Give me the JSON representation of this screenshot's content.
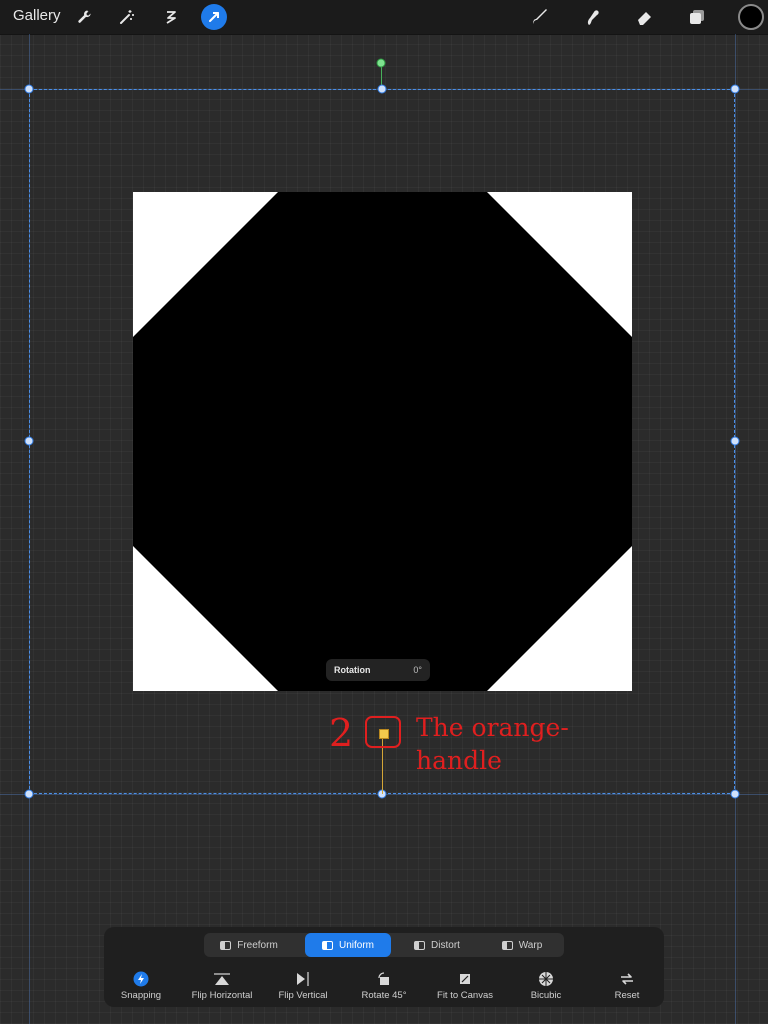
{
  "toolbar": {
    "gallery_label": "Gallery",
    "tools": [
      {
        "icon": "wrench-icon",
        "active": false
      },
      {
        "icon": "magic-wand-icon",
        "active": false
      },
      {
        "icon": "selection-icon",
        "active": false
      },
      {
        "icon": "transform-arrow-icon",
        "active": true
      }
    ],
    "right_tools": [
      "brush-icon",
      "smudge-icon",
      "eraser-icon",
      "layers-icon"
    ],
    "current_color": "#000000",
    "accent_color": "#1f7bea"
  },
  "canvas": {
    "artwork_background": "#ffffff",
    "shape_color": "#000000",
    "rotation_label": "Rotation",
    "rotation_value": "0°"
  },
  "annotation": {
    "number": "2",
    "text": "The orange-handle",
    "color": "#e01f1f",
    "handle_color": "#f2c94c"
  },
  "transform_modes": [
    {
      "label": "Freeform",
      "active": false
    },
    {
      "label": "Uniform",
      "active": true
    },
    {
      "label": "Distort",
      "active": false
    },
    {
      "label": "Warp",
      "active": false
    }
  ],
  "transform_options": [
    {
      "label": "Snapping",
      "icon": "snapping-icon"
    },
    {
      "label": "Flip Horizontal",
      "icon": "flip-horizontal-icon"
    },
    {
      "label": "Flip Vertical",
      "icon": "flip-vertical-icon"
    },
    {
      "label": "Rotate 45°",
      "icon": "rotate-icon"
    },
    {
      "label": "Fit to Canvas",
      "icon": "fit-canvas-icon"
    },
    {
      "label": "Bicubic",
      "icon": "bicubic-icon"
    },
    {
      "label": "Reset",
      "icon": "reset-icon"
    }
  ]
}
